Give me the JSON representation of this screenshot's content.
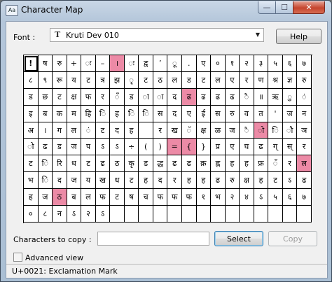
{
  "window": {
    "title": "Character Map",
    "min": "—",
    "max": "☐",
    "close": "✕",
    "icon": "Aa"
  },
  "font": {
    "label": "Font :",
    "value": "Kruti Dev 010",
    "type_glyph": "T",
    "dropdown_arrow": "▼"
  },
  "buttons": {
    "help": "Help",
    "select": "Select",
    "copy": "Copy"
  },
  "copy": {
    "label": "Characters to copy :",
    "value": ""
  },
  "advanced": {
    "label": "Advanced view",
    "checked": false
  },
  "status": {
    "text": "U+0021: Exclamation Mark"
  },
  "highlight_color": "#ec8aa6",
  "grid": {
    "highlighted": [
      6,
      51,
      96,
      110,
      111,
      139,
      162
    ],
    "selected": 0,
    "chars": [
      "!",
      "ष",
      "रु",
      "+",
      "ः",
      "–",
      "।",
      "ः",
      "द्व",
      "’",
      "ू",
      ".",
      "ए",
      "०",
      "१",
      "२",
      "३",
      "५",
      "६",
      "७",
      "८",
      "९",
      "रू",
      "य",
      "ट",
      "त्र",
      "झ",
      "ृ",
      "ट",
      "ठ",
      "ल",
      "ड",
      "ट",
      "ल",
      "ए",
      "र",
      "ण",
      "श्र",
      "ज्ञ",
      "रु",
      "ड",
      "छ",
      "ट",
      "क्ष",
      "फ",
      "र",
      "ँ",
      "ड",
      "ा",
      "ा",
      "द",
      "ढ",
      "ढ",
      "ढ",
      "ढ",
      "ै",
      "॥",
      "ऋ",
      "ु",
      "ं",
      "इ",
      "ब",
      "क",
      "म",
      "हि",
      "ि",
      "ह",
      "ि",
      "ि",
      "स",
      "द",
      "ए",
      "ई",
      "स",
      "रु",
      "व",
      "त",
      "'",
      "ज",
      "न",
      "अ",
      "।",
      "ग",
      "ल",
      "ं",
      "ट",
      "द",
      "ह",
      "",
      "र",
      "ख",
      "ॅ",
      "क्ष",
      "ळ",
      "ज",
      "ै",
      "ो",
      "ि",
      "ौ",
      "ञ",
      "ो",
      "ढ",
      "ड",
      "ज",
      "प",
      "ऽ",
      "ऽ",
      "÷",
      "(",
      ")",
      "=",
      "{",
      "}",
      "प्र",
      "ए",
      "घ",
      "ढ",
      "ग्",
      "स्",
      "र",
      "ट",
      "ि",
      "रि",
      "ध",
      "ट",
      "ढ",
      "ठ",
      "कृ",
      "ड",
      "द्ध",
      "ढ",
      "ढ",
      "क्र",
      "ह्न",
      "ह",
      "ह",
      "फ्र",
      "ँ",
      "र",
      "ल",
      "भ",
      "ि",
      "द",
      "ज",
      "य",
      "ख",
      "ध",
      "ट",
      "ह",
      "द",
      "र",
      "ह",
      "ह",
      "ढ",
      "रु",
      "क्ष",
      "ह",
      "ट",
      "ऽ",
      "ढ",
      "ह",
      "ज",
      "ठ",
      "ब",
      "ल",
      "फ",
      "ट",
      "ष",
      "च",
      "फ",
      "फ",
      "फ",
      "१",
      "भ",
      "२",
      "४",
      "ऽ",
      "५",
      "६",
      "७",
      "०",
      "८",
      "न",
      "ऽ",
      "२",
      "ऽ"
    ]
  }
}
